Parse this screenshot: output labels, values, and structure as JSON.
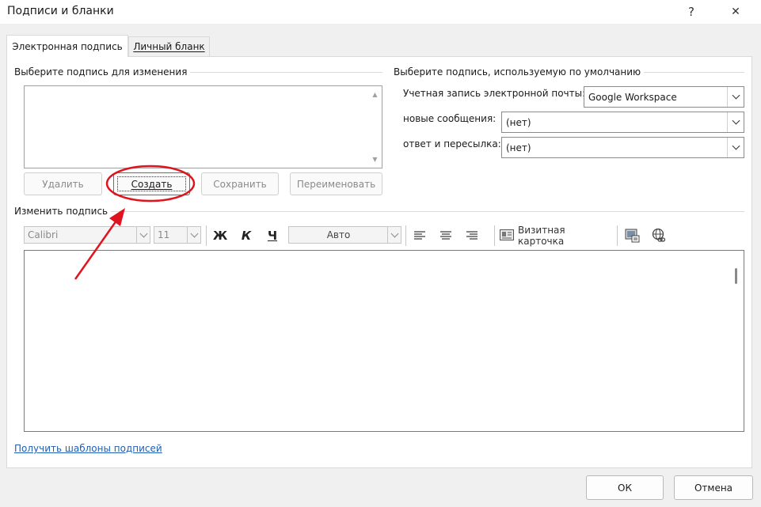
{
  "window": {
    "title": "Подписи и бланки",
    "help_glyph": "?",
    "close_glyph": "✕"
  },
  "tabs": [
    {
      "label": "Электронная подпись",
      "active": true
    },
    {
      "label": "Личный бланк",
      "active": false
    }
  ],
  "left_group": {
    "title": "Выберите подпись для изменения",
    "signatures": [],
    "buttons": {
      "delete": "Удалить",
      "create": "Создать",
      "save": "Сохранить",
      "rename": "Переименовать"
    }
  },
  "right_group": {
    "title": "Выберите подпись, используемую по умолчанию",
    "account_label": "Учетная запись электронной почты:",
    "account_value": "Google Workspace",
    "new_messages_label": "новые сообщения:",
    "new_messages_value": "(нет)",
    "reply_label": "ответ и пересылка:",
    "reply_value": "(нет)"
  },
  "edit_group": {
    "title": "Изменить подпись",
    "font": "Calibri",
    "font_size": "11",
    "bold": "Ж",
    "italic": "К",
    "underline": "Ч",
    "color": "Авто",
    "business_card": "Визитная карточка",
    "icons": [
      "align-left-icon",
      "align-center-icon",
      "align-right-icon",
      "business-card-icon",
      "insert-picture-icon",
      "insert-hyperlink-icon"
    ]
  },
  "templates_link": "Получить шаблоны подписей",
  "footer": {
    "ok": "ОК",
    "cancel": "Отмена"
  },
  "annotation": {
    "color": "#e0141e"
  }
}
